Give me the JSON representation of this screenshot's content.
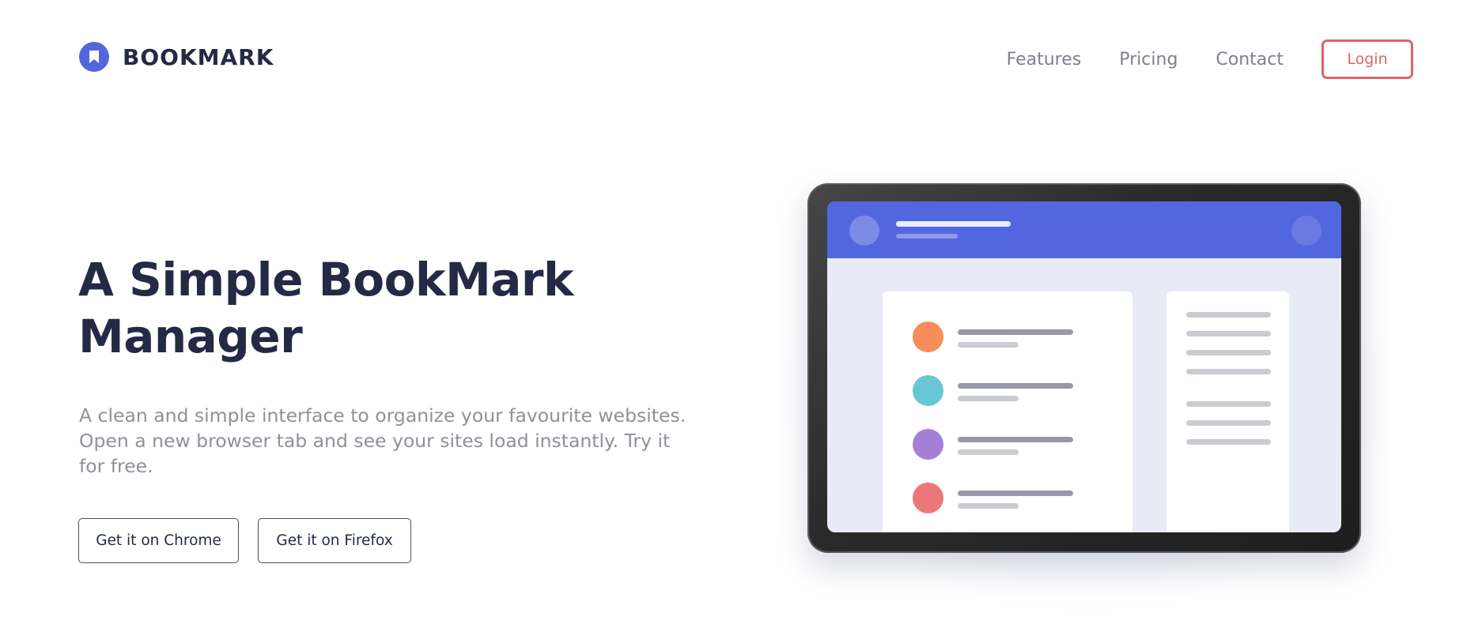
{
  "header": {
    "logo_text": "BOOKMARK",
    "logo_icon": "bookmark-icon",
    "nav": [
      {
        "label": "Features"
      },
      {
        "label": "Pricing"
      },
      {
        "label": "Contact"
      }
    ],
    "login_label": "Login"
  },
  "hero": {
    "title_line1": "A Simple BookMark",
    "title_line2": "Manager",
    "description_line1": "A clean and simple interface to organize your favourite websites.",
    "description_line2": "Open a new browser tab and see your sites load instantly. Try it",
    "description_line3": "for free.",
    "cta_chrome": "Get it on Chrome",
    "cta_firefox": "Get it on Firefox"
  },
  "illustration": {
    "list_dot_colors": [
      "#F68D5A",
      "#68C6D5",
      "#A57FD6",
      "#EB7778"
    ]
  },
  "colors": {
    "brand": "#5267DF",
    "accent_red": "#E06464",
    "heading": "#242A45",
    "muted": "#8f9199"
  }
}
